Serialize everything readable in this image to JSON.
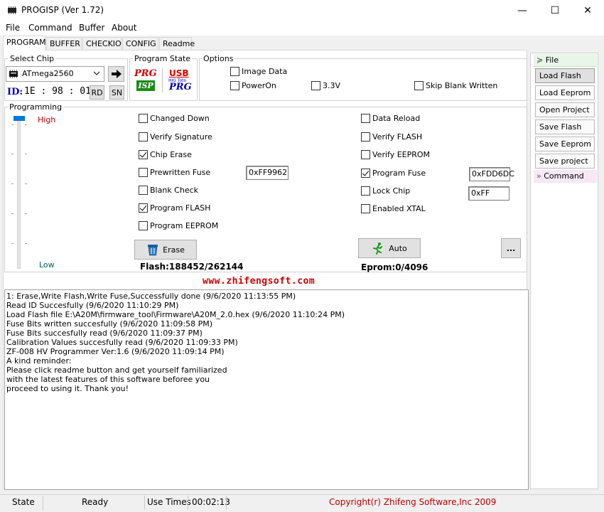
{
  "window": {
    "title": "PROGISP (Ver 1.72)",
    "minimize_glyph": "—",
    "maximize_glyph": "☐",
    "close_glyph": "✕"
  },
  "menu": [
    "File",
    "Command",
    "Buffer",
    "About"
  ],
  "tabs": [
    "PROGRAM",
    "BUFFER",
    "CHECKIO",
    "CONFIG",
    "Readme"
  ],
  "select_chip": {
    "label": "Select Chip",
    "value": "ATmega2560",
    "id_label": "ID:",
    "id_value": "1E : 98 : 01",
    "rd_label": "RD",
    "sn_label": "SN"
  },
  "program_state": {
    "label": "Program State",
    "prg": "PRG",
    "isp": "ISP",
    "usb": "USB",
    "usb_small": "HIG Toto",
    "prg2": "PRG"
  },
  "options": {
    "label": "Options",
    "image_data": "Image Data",
    "power_on": "PowerOn",
    "v33": "3.3V",
    "skip_blank": "Skip Blank Written"
  },
  "programming": {
    "label": "Programming",
    "high": "High",
    "low": "Low",
    "changed_down": "Changed Down",
    "verify_signature": "Verify Signature",
    "chip_erase": "Chip Erase",
    "prewritten_fuse": "Prewritten Fuse",
    "prewritten_fuse_value": "0xFF9962",
    "blank_check": "Blank Check",
    "program_flash": "Program FLASH",
    "program_eeprom": "Program EEPROM",
    "data_reload": "Data Reload",
    "verify_flash": "Verify FLASH",
    "verify_eeprom": "Verify EEPROM",
    "program_fuse": "Program Fuse",
    "program_fuse_value": "0xFDD6DC",
    "lock_chip": "Lock Chip",
    "lock_chip_value": "0xFF",
    "enabled_xtal": "Enabled XTAL",
    "erase_button": "Erase",
    "auto_button": "Auto",
    "more_button": "...",
    "flash_info": "Flash:188452/262144",
    "eprom_info": "Eprom:0/4096"
  },
  "website": "www.zhifengsoft.com",
  "log": [
    "1: Erase,Write Flash,Write Fuse,Successfully done (9/6/2020 11:13:55 PM)",
    "Read ID Succesfully (9/6/2020 11:10:29 PM)",
    "Load Flash file E:\\A20M\\firmware_tool\\Firmware\\A20M_2.0.hex (9/6/2020 11:10:24 PM)",
    "Fuse Bits written succesfully (9/6/2020 11:09:58 PM)",
    "Fuse Bits succesfully read (9/6/2020 11:09:37 PM)",
    "Calibration Values succesfully read (9/6/2020 11:09:33 PM)",
    "ZF-008 HV Programmer Ver:1.6 (9/6/2020 11:09:14 PM)",
    "A kind reminder:",
    "Please click readme button and get yourself familiarized",
    "with the latest features of this software beforee you",
    "proceed to using it. Thank you!"
  ],
  "side": {
    "file_header": "File",
    "load_flash": "Load Flash",
    "load_eeprom": "Load Eeprom",
    "open_project": "Open Project",
    "save_flash": "Save Flash",
    "save_eeprom": "Save Eeprom",
    "save_project": "Save project",
    "command_header": "Command"
  },
  "status": {
    "state_label": "State",
    "state_value": "Ready",
    "use_times_label": "Use Times",
    "use_times_value": "00:02:13",
    "copyright": "Copyright(r) Zhifeng Software,Inc 2009"
  },
  "colors": {
    "accent_blue": "#0078d7",
    "logo_red": "#d40000",
    "logo_blue": "#0000b0",
    "website_red": "#d00000",
    "copyright_red": "#c00000"
  }
}
